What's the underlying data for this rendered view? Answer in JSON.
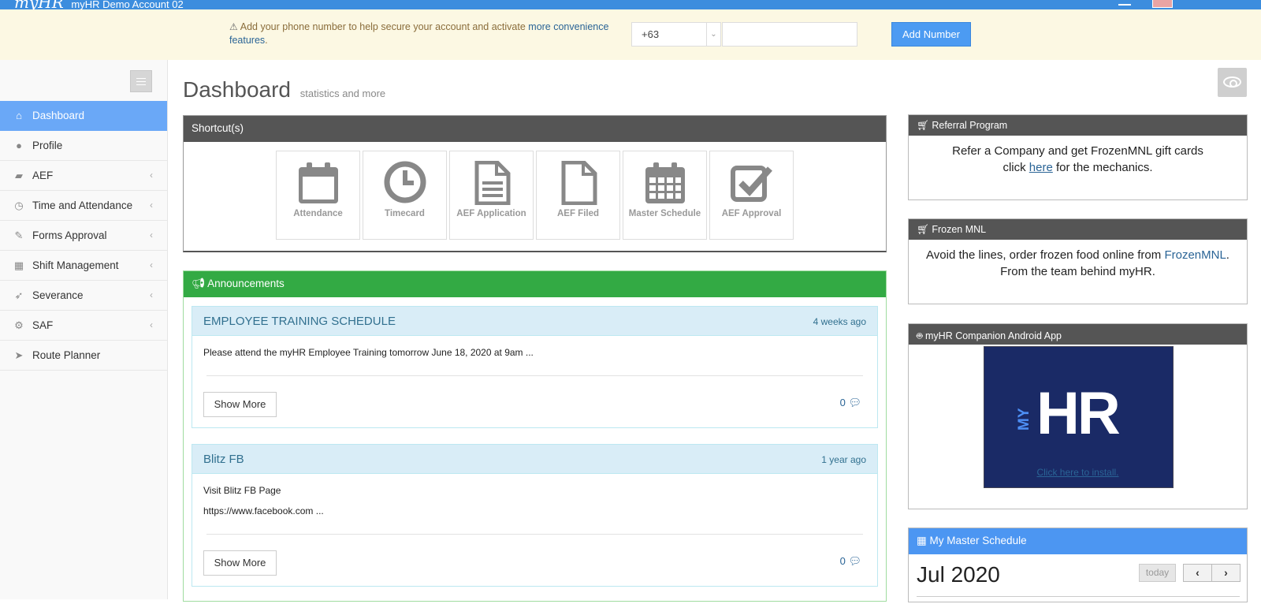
{
  "topbar": {
    "logo": "myHR",
    "account": "myHR Demo Account 02"
  },
  "banner": {
    "message": "Add your phone number to help secure your account and activate ",
    "link": "more convenience features",
    "suffix": ".",
    "country_code": "+63",
    "phone_value": "",
    "add_button": "Add Number"
  },
  "sidebar": {
    "items": [
      {
        "label": "Dashboard",
        "icon": "home-icon"
      },
      {
        "label": "Profile",
        "icon": "user-icon"
      },
      {
        "label": "AEF",
        "icon": "folder-open-icon"
      },
      {
        "label": "Time and Attendance",
        "icon": "clock-icon"
      },
      {
        "label": "Forms Approval",
        "icon": "pencil-icon"
      },
      {
        "label": "Shift Management",
        "icon": "calendar-icon"
      },
      {
        "label": "Severance",
        "icon": "rocket-icon"
      },
      {
        "label": "SAF",
        "icon": "gear-icon"
      },
      {
        "label": "Route Planner",
        "icon": "location-arrow-icon"
      }
    ]
  },
  "page": {
    "title": "Dashboard",
    "subtitle": "statistics and more"
  },
  "shortcuts": {
    "title": "Shortcut(s)",
    "tiles": [
      {
        "label": "Attendance",
        "icon": "calendar-icon"
      },
      {
        "label": "Timecard",
        "icon": "clock-icon"
      },
      {
        "label": "AEF Application",
        "icon": "file-text-icon"
      },
      {
        "label": "AEF Filed",
        "icon": "file-icon"
      },
      {
        "label": "Master Schedule",
        "icon": "calendar-grid-icon"
      },
      {
        "label": "AEF Approval",
        "icon": "check-square-icon"
      }
    ]
  },
  "announcements": {
    "title": "Announcements",
    "posts": [
      {
        "title": "EMPLOYEE TRAINING SCHEDULE",
        "date": "4 weeks ago",
        "lines": [
          "Please attend the myHR Employee Training tomorrow June 18, 2020 at 9am ..."
        ],
        "more": "Show More",
        "comments": "0"
      },
      {
        "title": "Blitz FB",
        "date": "1 year ago",
        "lines": [
          "Visit Blitz FB Page",
          "https://www.facebook.com ..."
        ],
        "more": "Show More",
        "comments": "0"
      }
    ]
  },
  "referral": {
    "title": "Referral Program",
    "line1": "Refer a Company and get FrozenMNL gift cards",
    "line2_pre": "click ",
    "line2_link": "here",
    "line2_post": " for the mechanics."
  },
  "frozen": {
    "title": "Frozen MNL",
    "line1_pre": "Avoid the lines, order frozen food online from ",
    "line1_link": "FrozenMNL",
    "line1_post": ".",
    "line2": "From the team behind myHR."
  },
  "app": {
    "title": "myHR Companion Android App",
    "logo_my": "MY",
    "logo_hr": "HR",
    "install": "Click here to install."
  },
  "schedule": {
    "title": "My Master Schedule",
    "month": "Jul 2020",
    "today": "today",
    "prev": "‹",
    "next": "›"
  },
  "colors": {
    "topbar": "#3c8dde",
    "active_nav": "#6aa8f7",
    "announcements": "#33aa44",
    "schedule_header": "#4c96f2"
  }
}
